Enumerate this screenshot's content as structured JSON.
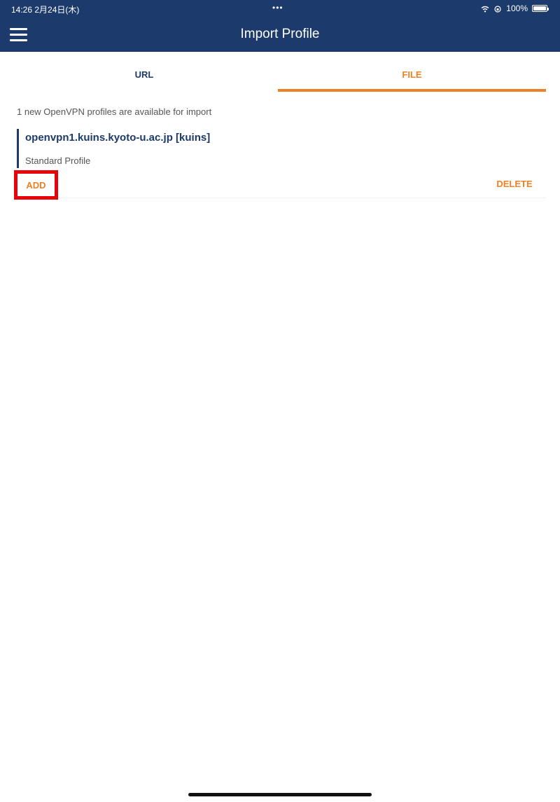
{
  "status_bar": {
    "time_date": "14:26  2月24日(木)",
    "center_dots": "•••",
    "battery": "100%",
    "icons": [
      "wifi-icon",
      "rotation-lock-icon",
      "battery-icon"
    ]
  },
  "nav": {
    "title": "Import Profile",
    "menu_icon": "hamburger-menu-icon"
  },
  "tabs": [
    {
      "label": "URL",
      "active": false
    },
    {
      "label": "FILE",
      "active": true
    }
  ],
  "content": {
    "info": "1 new OpenVPN profiles are available for import",
    "profile": {
      "title": "openvpn1.kuins.kyoto-u.ac.jp [kuins]",
      "subtitle": "Standard Profile"
    },
    "actions": {
      "add": "ADD",
      "delete": "DELETE"
    }
  },
  "colors": {
    "primary": "#1c3a6b",
    "accent": "#f08024",
    "highlight_box": "#e8000a"
  }
}
